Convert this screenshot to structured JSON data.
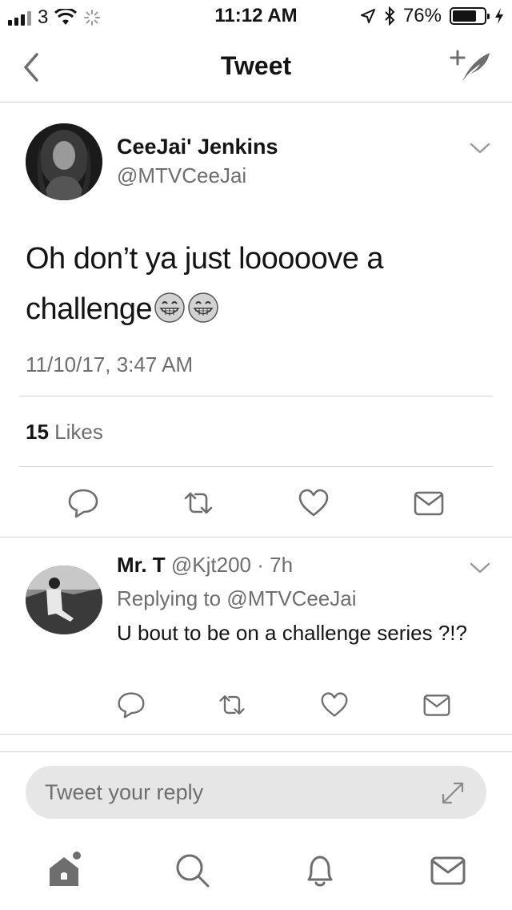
{
  "status_bar": {
    "carrier": "3",
    "time": "11:12 AM",
    "battery_percent": "76%",
    "battery_level": 0.76,
    "icons": [
      "signal-icon",
      "wifi-icon",
      "activity-spinner-icon",
      "location-arrow-icon",
      "bluetooth-icon",
      "battery-icon",
      "charging-bolt-icon"
    ]
  },
  "nav": {
    "title": "Tweet",
    "back_icon": "chevron-left-icon",
    "compose_icon": "compose-tweet-icon"
  },
  "tweet": {
    "author_name": "CeeJai' Jenkins",
    "author_handle": "@MTVCeeJai",
    "text": "Oh don’t ya just looooove a challenge",
    "emojis": [
      "grinning-face-emoji",
      "grinning-face-emoji"
    ],
    "timestamp": "11/10/17, 3:47 AM",
    "likes_count": "15",
    "likes_label": "Likes",
    "actions": [
      "reply-icon",
      "retweet-icon",
      "like-icon",
      "direct-message-icon"
    ]
  },
  "reply": {
    "author_name": "Mr. T",
    "author_handle": "@Kjt200",
    "separator": "·",
    "time_ago": "7h",
    "replying_to": "Replying to @MTVCeeJai",
    "text": "U bout to be on a challenge series ?!?",
    "actions": [
      "reply-icon",
      "retweet-icon",
      "like-icon",
      "direct-message-icon"
    ]
  },
  "composer": {
    "placeholder": "Tweet your reply",
    "value": ""
  },
  "tab_bar": {
    "items": [
      "home-icon",
      "search-icon",
      "notifications-icon",
      "messages-icon"
    ],
    "home_has_badge": true
  }
}
